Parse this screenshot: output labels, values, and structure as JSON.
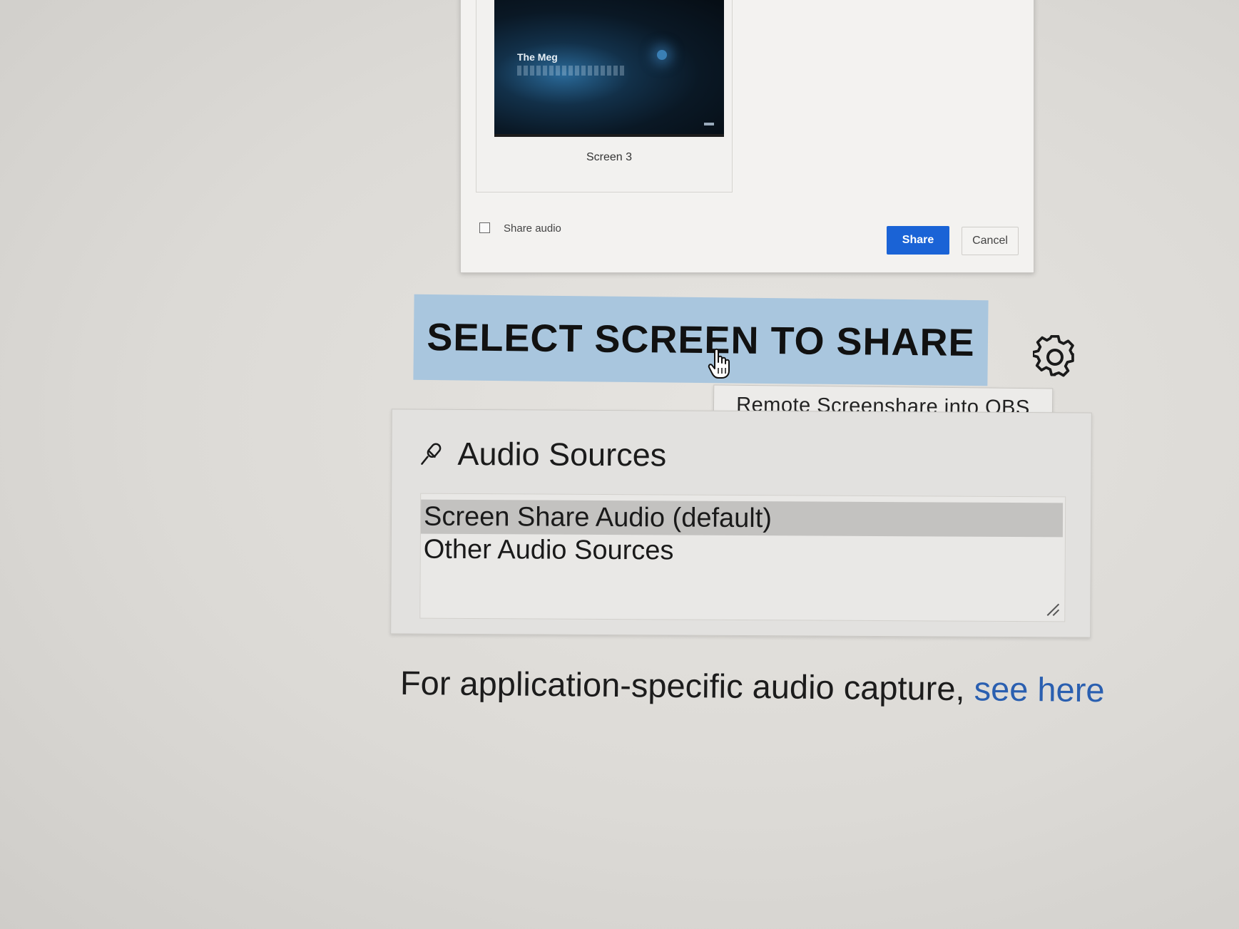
{
  "share_dialog": {
    "thumbnail_title": "The Meg",
    "screen_label": "Screen 3",
    "share_audio_label": "Share audio",
    "share_audio_checked": false,
    "share_button": "Share",
    "cancel_button": "Cancel",
    "share_color": "#1a63d6"
  },
  "main": {
    "select_button": "SELECT SCREEN TO SHARE",
    "select_button_color": "#a9c6de",
    "settings_icon": "gear-icon",
    "tooltip": "Remote Screenshare into OBS"
  },
  "audio": {
    "title": "Audio Sources",
    "icon": "microphone-icon",
    "options": [
      {
        "label": "Screen Share Audio (default)",
        "selected": true
      },
      {
        "label": "Other Audio Sources",
        "selected": false
      }
    ]
  },
  "footer": {
    "text": "For application-specific audio capture, ",
    "link": "see here",
    "link_color": "#2a5fb0"
  }
}
